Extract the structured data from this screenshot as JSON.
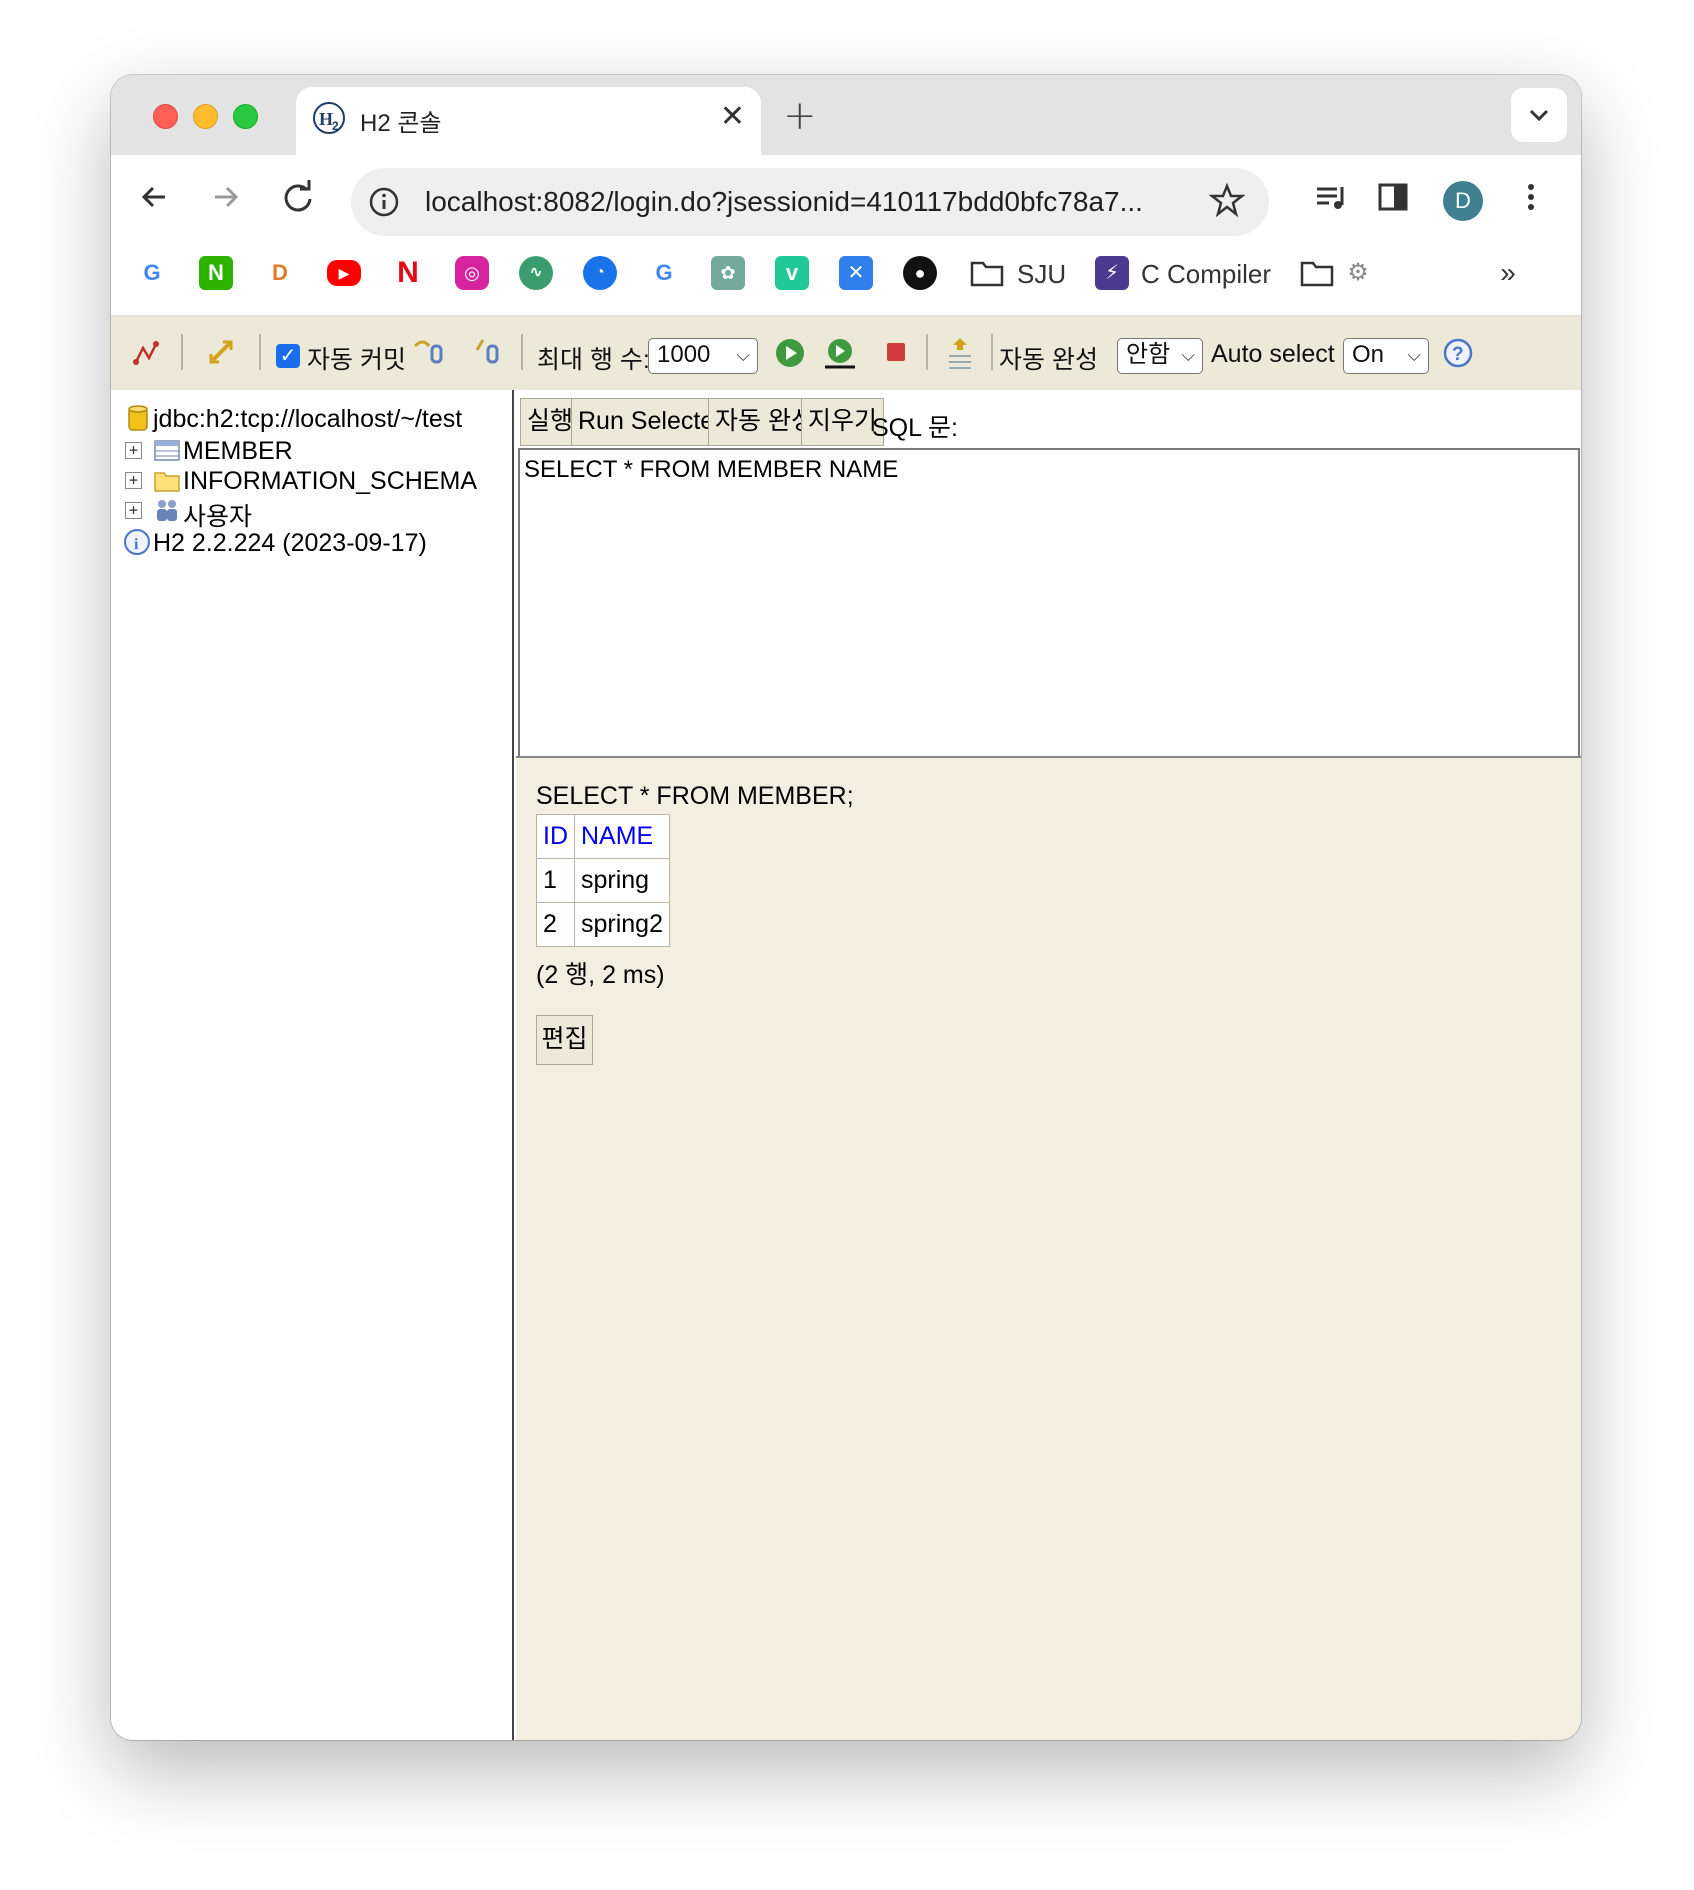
{
  "browser": {
    "tab_title": "H2 콘솔",
    "url": "localhost:8082/login.do?jsessionid=410117bdd0bfc78a7...",
    "avatar_letter": "D",
    "bookmarks": {
      "sju": "SJU",
      "c_compiler": "C Compiler"
    }
  },
  "h2_toolbar": {
    "auto_commit": "자동 커밋",
    "max_rows_label": "최대 행 수:",
    "max_rows_value": "1000",
    "autocomplete_label": "자동 완성",
    "autocomplete_value": "안함",
    "auto_select_label": "Auto select",
    "auto_select_value": "On"
  },
  "tree": {
    "connection": "jdbc:h2:tcp://localhost/~/test",
    "items": [
      {
        "label": "MEMBER"
      },
      {
        "label": "INFORMATION_SCHEMA"
      },
      {
        "label": "사용자"
      }
    ],
    "version": "H2 2.2.224 (2023-09-17)"
  },
  "sql": {
    "run": "실행",
    "run_selected": "Run Selected",
    "autocomplete": "자동 완성",
    "clear": "지우기",
    "label": "SQL 문:",
    "text": "SELECT * FROM MEMBER NAME"
  },
  "result": {
    "statement": "SELECT * FROM MEMBER;",
    "columns": [
      "ID",
      "NAME"
    ],
    "rows": [
      [
        "1",
        "spring"
      ],
      [
        "2",
        "spring2"
      ]
    ],
    "info": "(2 행, 2 ms)",
    "edit": "편집"
  }
}
